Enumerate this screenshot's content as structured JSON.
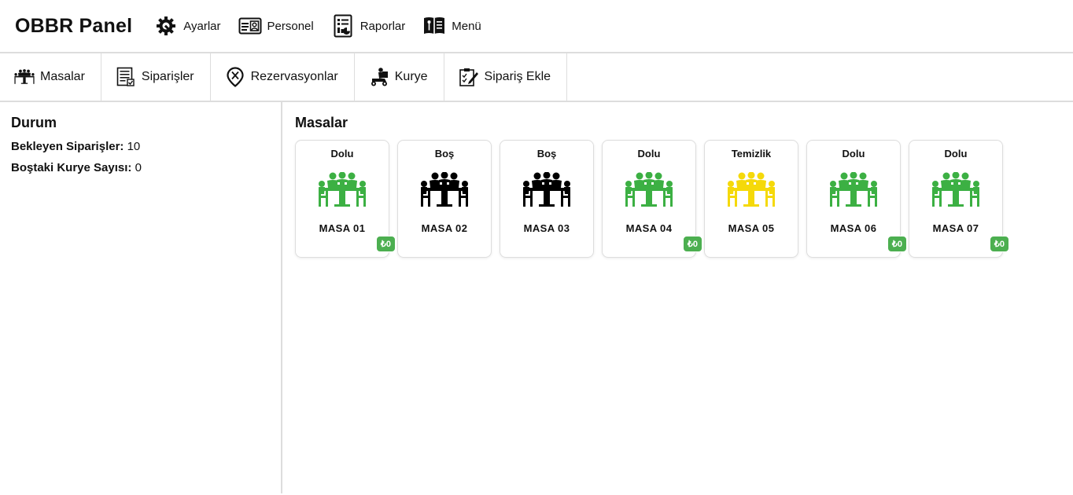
{
  "header": {
    "brand": "OBBR Panel",
    "nav": [
      {
        "label": "Ayarlar",
        "icon": "gear-wrench-icon"
      },
      {
        "label": "Personel",
        "icon": "id-card-icon"
      },
      {
        "label": "Raporlar",
        "icon": "report-icon"
      },
      {
        "label": "Menü",
        "icon": "menu-book-icon"
      }
    ]
  },
  "tabs": [
    {
      "label": "Masalar",
      "icon": "dining-table-icon"
    },
    {
      "label": "Siparişler",
      "icon": "order-list-icon"
    },
    {
      "label": "Rezervasyonlar",
      "icon": "location-pin-icon"
    },
    {
      "label": "Kurye",
      "icon": "courier-scooter-icon"
    },
    {
      "label": "Sipariş Ekle",
      "icon": "add-order-icon"
    }
  ],
  "sidebar": {
    "title": "Durum",
    "pending_label": "Bekleyen Siparişler:",
    "pending_value": "10",
    "courier_label": "Boştaki Kurye Sayısı:",
    "courier_value": "0"
  },
  "main": {
    "title": "Masalar",
    "tables": [
      {
        "status": "Dolu",
        "name": "MASA 01",
        "price": "₺0",
        "color": "#3cb043"
      },
      {
        "status": "Boş",
        "name": "MASA 02",
        "price": "",
        "color": "#000000"
      },
      {
        "status": "Boş",
        "name": "MASA 03",
        "price": "",
        "color": "#000000"
      },
      {
        "status": "Dolu",
        "name": "MASA 04",
        "price": "₺0",
        "color": "#3cb043"
      },
      {
        "status": "Temizlik",
        "name": "MASA 05",
        "price": "",
        "color": "#f5d90a"
      },
      {
        "status": "Dolu",
        "name": "MASA 06",
        "price": "₺0",
        "color": "#3cb043"
      },
      {
        "status": "Dolu",
        "name": "MASA 07",
        "price": "₺0",
        "color": "#3cb043"
      }
    ]
  },
  "colors": {
    "occupied": "#3cb043",
    "empty": "#000000",
    "cleaning": "#f5d90a",
    "badge": "#4caf50"
  }
}
